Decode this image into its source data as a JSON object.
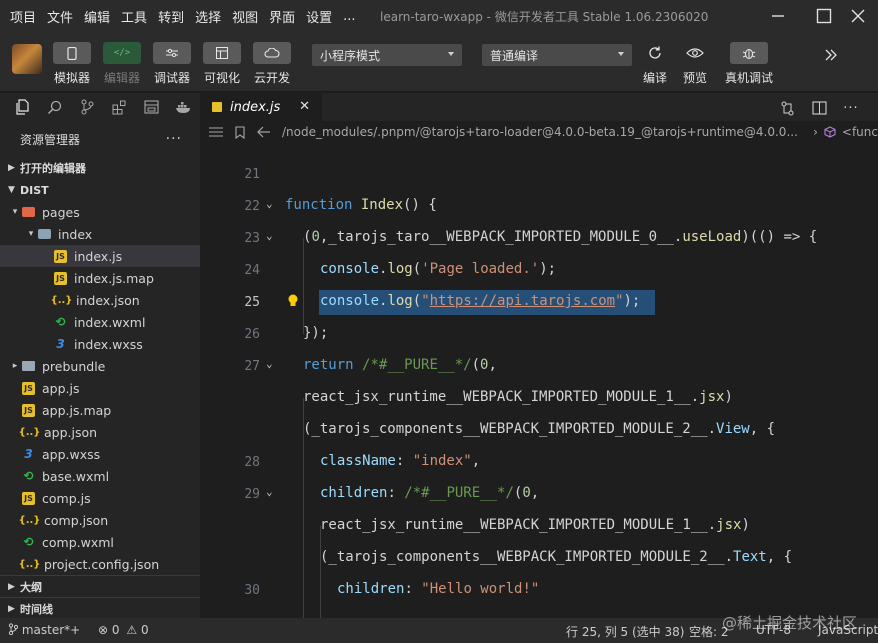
{
  "menu": [
    "项目",
    "文件",
    "编辑",
    "工具",
    "转到",
    "选择",
    "视图",
    "界面",
    "设置",
    "..."
  ],
  "window": {
    "title": "learn-taro-wxapp - 微信开发者工具 Stable 1.06.2306020"
  },
  "toolbar": {
    "simulator": "模拟器",
    "editor": "编辑器",
    "debugger": "调试器",
    "visual": "可视化",
    "cloud": "云开发",
    "mode_select": "小程序模式",
    "compile_select": "普通编译",
    "compile": "编译",
    "preview": "预览",
    "remote_debug": "真机调试"
  },
  "tabs": {
    "active": "index.js"
  },
  "breadcrumb": {
    "path": "/node_modules/.pnpm/@tarojs+taro-loader@4.0.0-beta.19_@tarojs+runtime@4.0.0...",
    "symbol": "<func"
  },
  "sidebar": {
    "title": "资源管理器",
    "open_editors": "打开的编辑器",
    "root": "DIST",
    "outline": "大纲",
    "timeline": "时间线",
    "tree": [
      {
        "name": "pages",
        "type": "folder-pages",
        "depth": 1,
        "open": true
      },
      {
        "name": "index",
        "type": "folder-open",
        "depth": 2,
        "open": true
      },
      {
        "name": "index.js",
        "type": "js",
        "depth": 3,
        "selected": true
      },
      {
        "name": "index.js.map",
        "type": "js",
        "depth": 3
      },
      {
        "name": "index.json",
        "type": "json",
        "depth": 3
      },
      {
        "name": "index.wxml",
        "type": "wxml",
        "depth": 3
      },
      {
        "name": "index.wxss",
        "type": "wxss",
        "depth": 3
      },
      {
        "name": "prebundle",
        "type": "folder",
        "depth": 1,
        "open": false
      },
      {
        "name": "app.js",
        "type": "js",
        "depth": 1
      },
      {
        "name": "app.js.map",
        "type": "js",
        "depth": 1
      },
      {
        "name": "app.json",
        "type": "json",
        "depth": 1
      },
      {
        "name": "app.wxss",
        "type": "wxss",
        "depth": 1
      },
      {
        "name": "base.wxml",
        "type": "wxml",
        "depth": 1
      },
      {
        "name": "comp.js",
        "type": "js",
        "depth": 1
      },
      {
        "name": "comp.json",
        "type": "json",
        "depth": 1
      },
      {
        "name": "comp.wxml",
        "type": "wxml",
        "depth": 1
      },
      {
        "name": "project.config.json",
        "type": "json",
        "depth": 1
      }
    ]
  },
  "code": {
    "lines": [
      {
        "num": "21",
        "text": ""
      },
      {
        "num": "22",
        "text": "function Index() {"
      },
      {
        "num": "23",
        "text": "(0,_tarojs_taro__WEBPACK_IMPORTED_MODULE_0__.useLoad)(() => {"
      },
      {
        "num": "24",
        "text": "console.log('Page loaded.');"
      },
      {
        "num": "25",
        "text": "console.log(\"https://api.tarojs.com\");"
      },
      {
        "num": "26",
        "text": "});"
      },
      {
        "num": "27",
        "text": "return /*#__PURE__*/(0,"
      },
      {
        "num": "",
        "text": "react_jsx_runtime__WEBPACK_IMPORTED_MODULE_1__.jsx)"
      },
      {
        "num": "",
        "text": "(_tarojs_components__WEBPACK_IMPORTED_MODULE_2__.View, {"
      },
      {
        "num": "28",
        "text": "className: \"index\","
      },
      {
        "num": "29",
        "text": "children: /*#__PURE__*/(0,"
      },
      {
        "num": "",
        "text": "react_jsx_runtime__WEBPACK_IMPORTED_MODULE_1__.jsx)"
      },
      {
        "num": "",
        "text": "(_tarojs_components__WEBPACK_IMPORTED_MODULE_2__.Text, {"
      },
      {
        "num": "30",
        "text": "children: \"Hello world!\""
      }
    ]
  },
  "status": {
    "branch": "master*+",
    "errors": "0",
    "warnings": "0",
    "position": "行 25, 列 5 (选中 38)",
    "indent": "空格: 2",
    "encoding": "UTF-8",
    "language": "JavaScript"
  },
  "watermark": "@稀土掘金技术社区"
}
